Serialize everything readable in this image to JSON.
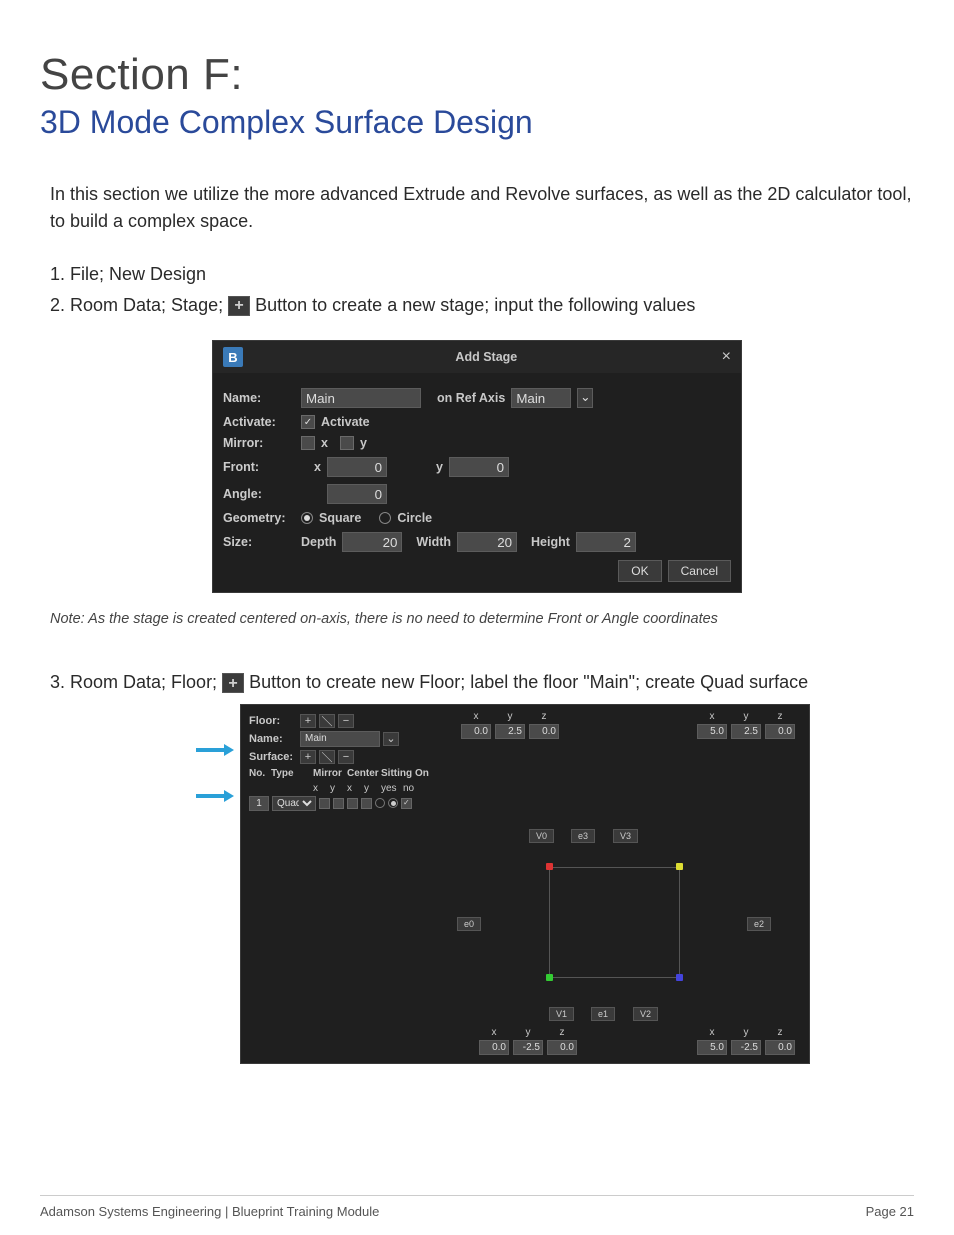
{
  "header": {
    "section": "Section F:",
    "subtitle": "3D Mode Complex Surface Design"
  },
  "intro": "In this section we utilize the more advanced Extrude and Revolve surfaces, as well as the 2D calculator tool, to build a complex space.",
  "steps": {
    "s1": "1. File; New Design",
    "s2a": "2. Room Data; Stage; ",
    "s2b": " Button to create a new stage; input the following values",
    "s3a": "3. Room Data; Floor; ",
    "s3b": " Button to create new Floor; label the floor \"Main\"; create Quad surface"
  },
  "note": "Note: As the stage is created centered on-axis, there is no need to determine Front or Angle coordinates",
  "dialog1": {
    "logo": "B",
    "title": "Add Stage",
    "labels": {
      "name": "Name:",
      "refaxis": "on Ref Axis",
      "activate_lbl": "Activate:",
      "activate_chk": "Activate",
      "mirror": "Mirror:",
      "x": "x",
      "y": "y",
      "front": "Front:",
      "front_x": "x",
      "front_y": "y",
      "angle": "Angle:",
      "geometry": "Geometry:",
      "square": "Square",
      "circle": "Circle",
      "size": "Size:",
      "depth": "Depth",
      "width": "Width",
      "height": "Height",
      "ok": "OK",
      "cancel": "Cancel"
    },
    "values": {
      "name": "Main",
      "refaxis": "Main",
      "front_x": "0",
      "front_y": "0",
      "angle": "0",
      "depth": "20",
      "width": "20",
      "height": "2"
    }
  },
  "dialog2": {
    "labels": {
      "floor": "Floor:",
      "name": "Name:",
      "surface": "Surface:",
      "no": "No.",
      "type": "Type",
      "mirror": "Mirror",
      "center": "Center",
      "sitting": "Sitting",
      "on": "On",
      "x": "x",
      "y": "y",
      "z": "z",
      "yes": "yes",
      "no_opt": "no"
    },
    "values": {
      "name": "Main",
      "rowno": "1",
      "type": "Quad"
    },
    "coords": {
      "tl": {
        "x": "0.0",
        "y": "2.5",
        "z": "0.0"
      },
      "tr": {
        "x": "5.0",
        "y": "2.5",
        "z": "0.0"
      },
      "bl": {
        "x": "0.0",
        "y": "-2.5",
        "z": "0.0"
      },
      "br": {
        "x": "5.0",
        "y": "-2.5",
        "z": "0.0"
      }
    },
    "vtags": {
      "v0": "V0",
      "v1": "V1",
      "v2": "V2",
      "v3": "V3",
      "e0": "e0",
      "e1": "e1",
      "e2": "e2",
      "e3": "e3"
    }
  },
  "footer": {
    "left": "Adamson Systems Engineering  |  Blueprint Training Module",
    "right": "Page 21"
  }
}
